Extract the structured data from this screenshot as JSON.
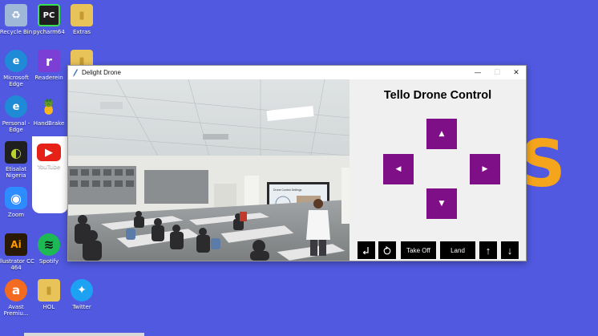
{
  "desktop": {
    "icons": [
      {
        "label": "Recycle Bin",
        "glyph": "♻",
        "color": "#9fb8d8"
      },
      {
        "label": "pycharm64",
        "glyph": "PC",
        "color": "#1f1f1f"
      },
      {
        "label": "Extras",
        "glyph": "▮",
        "color": "#e8c35a"
      },
      {
        "label": "Microsoft Edge",
        "glyph": "e",
        "color": "#1f8ad6"
      },
      {
        "label": "Readerein",
        "glyph": "r",
        "color": "#7b3fd6"
      },
      {
        "label": "",
        "glyph": "▮",
        "color": "#e8c35a"
      },
      {
        "label": "Personal - Edge",
        "glyph": "e",
        "color": "#1f8ad6"
      },
      {
        "label": "HandBrake",
        "glyph": "🍍",
        "color": "#c0392b"
      },
      {
        "label": "Etisalat Nigeria",
        "glyph": "◐",
        "color": "#1f1f1f"
      },
      {
        "label": "YouTube",
        "glyph": "▶",
        "color": "#e62117"
      },
      {
        "label": "Zoom",
        "glyph": "◉",
        "color": "#2d8cff"
      },
      {
        "label": "Illustrator CC 464",
        "glyph": "Ai",
        "color": "#2a1a05"
      },
      {
        "label": "Spotify",
        "glyph": "≋",
        "color": "#1db954"
      },
      {
        "label": "Avast Premiu...",
        "glyph": "a",
        "color": "#f36b21"
      },
      {
        "label": "HOL",
        "glyph": "▮",
        "color": "#e8c35a"
      },
      {
        "label": "Twitter",
        "glyph": "✦",
        "color": "#1da1f2"
      }
    ],
    "bg_letter": "S"
  },
  "window": {
    "title": "Delight Drone",
    "minimize": "—",
    "maximize": "☐",
    "close": "✕"
  },
  "video": {
    "screen_title": "Drone Control Settings"
  },
  "panel": {
    "title": "Tello Drone Control",
    "up": "▲",
    "left": "◀",
    "right": "▶",
    "down": "▼",
    "takeoff": "Take Off",
    "land": "Land",
    "ascend": "↑",
    "descend": "↓"
  },
  "colors": {
    "desktop": "#5059e0",
    "accent_purple": "#7f0f87",
    "bottom_button": "#000000"
  }
}
